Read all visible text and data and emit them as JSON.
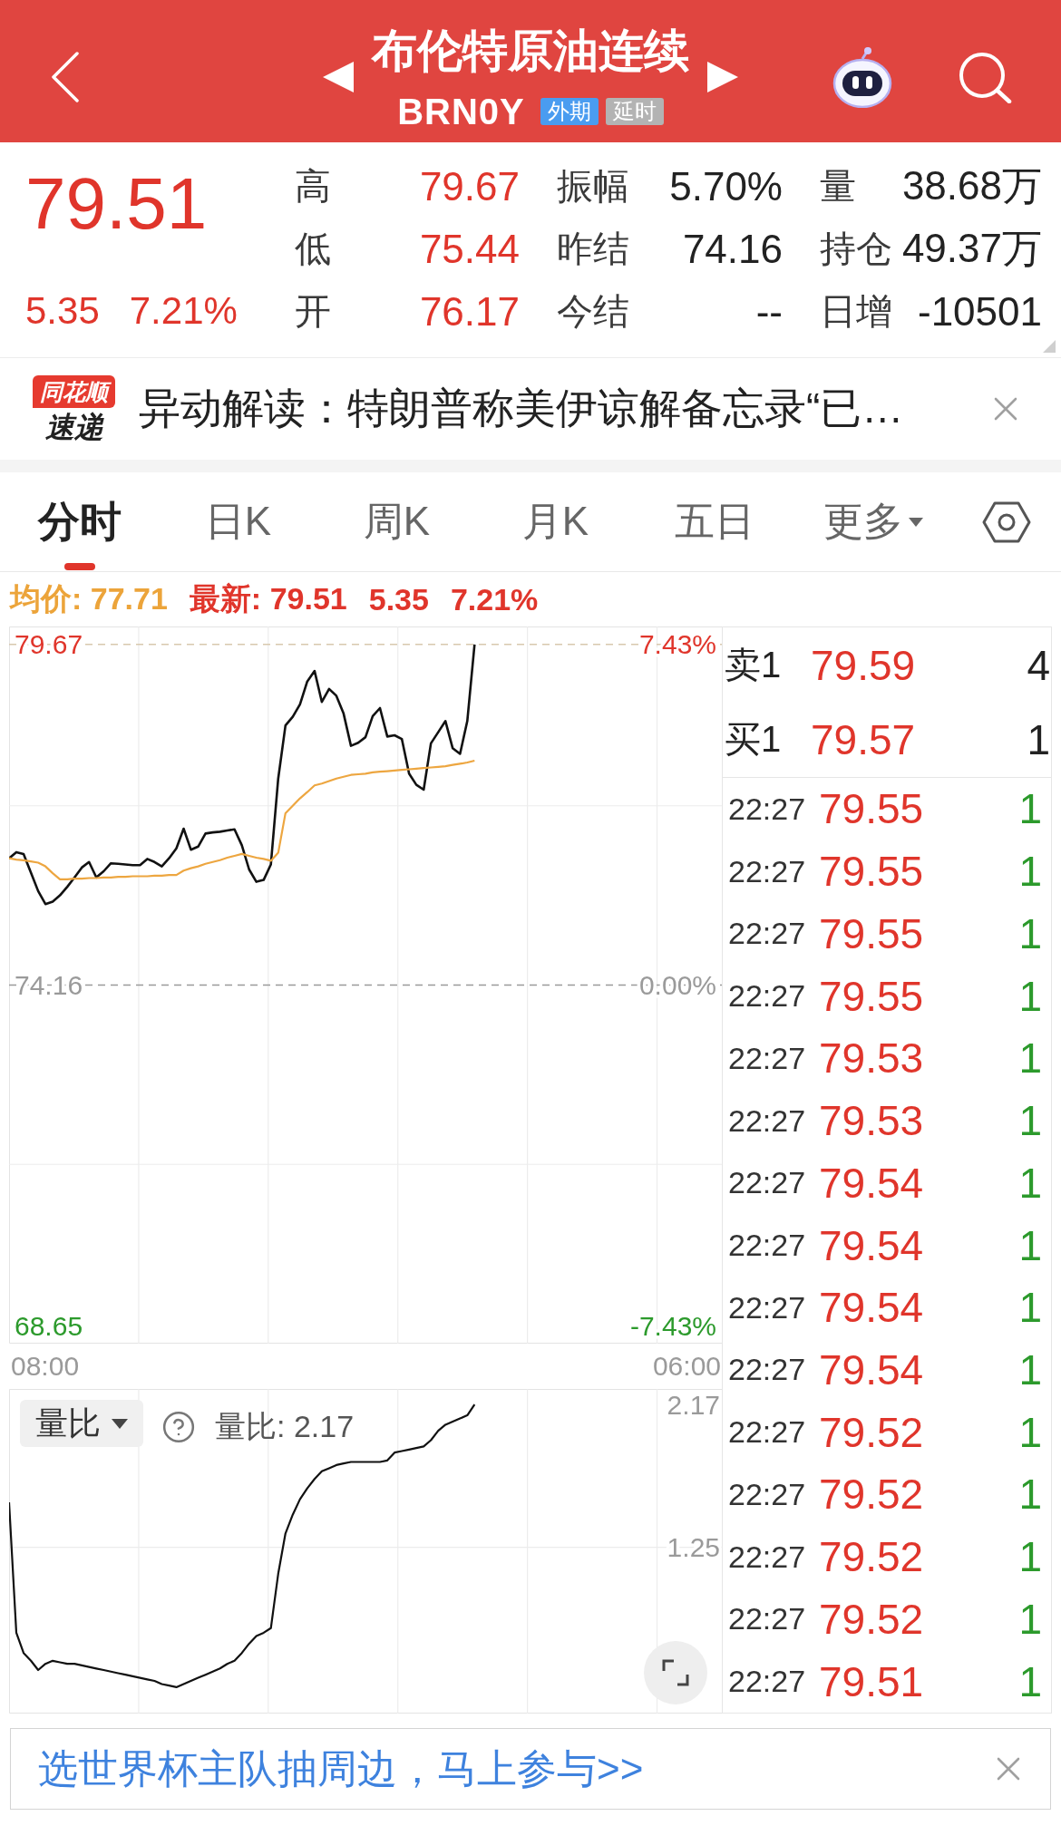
{
  "header": {
    "title": "布伦特原油连续",
    "code": "BRN0Y",
    "tags": [
      {
        "label": "外期",
        "color": "#4a9cf0"
      },
      {
        "label": "延时",
        "color": "#b3b3b3"
      }
    ]
  },
  "quote": {
    "price": "79.51",
    "change": "5.35",
    "percent": "7.21%",
    "stats": [
      {
        "label": "高",
        "value": "79.67",
        "color": "#e0352b"
      },
      {
        "label": "振幅",
        "value": "5.70%",
        "color": "#222222"
      },
      {
        "label": "量",
        "value": "38.68万",
        "color": "#222222"
      },
      {
        "label": "低",
        "value": "75.44",
        "color": "#e0352b"
      },
      {
        "label": "昨结",
        "value": "74.16",
        "color": "#222222"
      },
      {
        "label": "持仓",
        "value": "49.37万",
        "color": "#222222"
      },
      {
        "label": "开",
        "value": "76.17",
        "color": "#e0352b"
      },
      {
        "label": "今结",
        "value": "--",
        "color": "#222222"
      },
      {
        "label": "日增",
        "value": "-10501",
        "color": "#222222"
      }
    ]
  },
  "news": {
    "brand": "同花顺",
    "brand_sub": "速递",
    "headline": "异动解读：特朗普称美伊谅解备忘录“已…"
  },
  "tabs": [
    {
      "label": "分时",
      "selected": true,
      "kind": "tab"
    },
    {
      "label": "日K",
      "selected": false,
      "kind": "tab"
    },
    {
      "label": "周K",
      "selected": false,
      "kind": "tab"
    },
    {
      "label": "月K",
      "selected": false,
      "kind": "tab"
    },
    {
      "label": "五日",
      "selected": false,
      "kind": "tab"
    },
    {
      "label": "更多",
      "selected": false,
      "kind": "menu"
    }
  ],
  "summary": {
    "average": "均价: 77.71",
    "latest": "最新: 79.51",
    "change": "5.35",
    "percent": "7.21%"
  },
  "price_chart": {
    "right_labels": [
      "7.43%",
      "0.00%",
      "-7.43%"
    ],
    "chart_data": {
      "type": "line",
      "grid": true,
      "categories": [
        null,
        null,
        null,
        null,
        null,
        "08:00",
        null,
        null,
        null,
        null,
        null,
        null,
        null,
        null,
        null,
        null,
        null,
        null,
        null,
        null,
        null,
        null,
        null,
        null,
        null,
        null,
        null,
        null,
        null,
        null,
        null,
        null,
        null,
        null,
        null,
        null,
        null,
        null,
        null,
        null,
        null,
        null,
        null,
        null,
        null,
        null,
        null,
        null,
        null,
        null,
        null,
        null,
        null,
        null,
        null,
        null,
        null,
        null,
        null,
        null,
        null,
        null,
        null,
        null,
        null,
        null,
        null,
        null,
        null,
        null,
        null,
        null,
        null,
        null,
        null,
        null,
        null,
        null,
        null,
        null,
        null,
        null,
        null,
        null,
        null,
        null,
        null,
        null,
        null,
        null,
        null,
        null,
        null,
        "06:00",
        null,
        null,
        null,
        null,
        null
      ],
      "series": [
        {
          "color": "#111111",
          "values": [
            76.21,
            76.31,
            76.28,
            75.98,
            75.68,
            75.47,
            75.51,
            75.61,
            75.75,
            75.9,
            76.06,
            76.15,
            75.9,
            76.0,
            76.13,
            76.12,
            76.11,
            76.1,
            76.1,
            76.2,
            76.15,
            76.08,
            76.21,
            76.37,
            76.69,
            76.35,
            76.4,
            76.61,
            76.63,
            76.64,
            76.66,
            76.68,
            76.42,
            76.03,
            75.83,
            75.86,
            76.11,
            77.5,
            78.36,
            78.5,
            78.7,
            79.07,
            79.24,
            78.74,
            78.95,
            78.84,
            78.55,
            78.03,
            78.08,
            78.17,
            78.51,
            78.64,
            78.18,
            78.2,
            78.14,
            77.58,
            77.4,
            77.32,
            78.07,
            78.25,
            78.43,
            77.99,
            77.9,
            78.43,
            79.67,
            null,
            null,
            null,
            null,
            null,
            null,
            null,
            null,
            null,
            null,
            null,
            null,
            null,
            null,
            null,
            null,
            null,
            null,
            null,
            null,
            null,
            null,
            null,
            null,
            null,
            null,
            null,
            null,
            null,
            null,
            null,
            null,
            null,
            null
          ]
        },
        {
          "color": "#eda640",
          "values": [
            76.21,
            76.19,
            76.18,
            76.16,
            76.14,
            76.08,
            75.97,
            75.87,
            75.87,
            75.88,
            75.88,
            75.89,
            75.89,
            75.9,
            75.9,
            75.91,
            75.91,
            75.92,
            75.92,
            75.92,
            75.93,
            75.93,
            75.94,
            75.94,
            76.01,
            76.05,
            76.08,
            76.12,
            76.15,
            76.18,
            76.22,
            76.25,
            76.28,
            76.25,
            76.22,
            76.2,
            76.17,
            76.3,
            76.94,
            77.06,
            77.18,
            77.28,
            77.39,
            77.42,
            77.46,
            77.5,
            77.53,
            77.56,
            77.57,
            77.58,
            77.6,
            77.61,
            77.62,
            77.63,
            77.64,
            77.65,
            77.66,
            77.67,
            77.68,
            77.69,
            77.7,
            77.72,
            77.74,
            77.76,
            77.79,
            null,
            null,
            null,
            null,
            null,
            null,
            null,
            null,
            null,
            null,
            null,
            null,
            null,
            null,
            null,
            null,
            null,
            null,
            null,
            null,
            null,
            null,
            null,
            null,
            null,
            null,
            null,
            null,
            null,
            null,
            null,
            null,
            null,
            null
          ]
        }
      ],
      "ref_lines": [
        {
          "axis": "y",
          "value": 79.67,
          "color": "#d8c8ae"
        },
        {
          "axis": "y",
          "value": 74.16,
          "color": "#9a9a9a"
        }
      ],
      "ylim": [
        68.36,
        79.96
      ],
      "yticks": [
        {
          "value": 68.65,
          "label": "68.65"
        },
        {
          "value": 74.16,
          "label": "74.16"
        },
        {
          "value": 79.67,
          "label": "79.67"
        }
      ]
    }
  },
  "volume_chart": {
    "indicator": "量比",
    "reading": "量比: 2.17",
    "chart_data": {
      "type": "line",
      "grid": true,
      "categories": [
        null,
        null,
        null,
        null,
        null,
        null,
        null,
        null,
        null,
        null,
        null,
        null,
        null,
        null,
        null,
        null,
        null,
        null,
        null,
        null,
        null,
        null,
        null,
        null,
        null,
        null,
        null,
        null,
        null,
        null,
        null,
        null,
        null,
        null,
        null,
        null,
        null,
        null,
        null,
        null,
        null,
        null,
        null,
        null,
        null,
        null,
        null,
        null,
        null,
        null,
        null,
        null,
        null,
        null,
        null,
        null,
        null,
        null,
        null,
        null,
        null,
        null,
        null,
        null,
        null,
        null,
        null,
        null,
        null,
        null,
        null,
        null,
        null,
        null,
        null,
        null,
        null,
        null,
        null,
        null,
        null,
        null,
        null,
        null,
        null,
        null,
        null,
        null,
        null,
        null,
        null,
        null,
        null,
        null,
        null,
        null,
        null,
        null,
        null
      ],
      "series": [
        {
          "color": "#111111",
          "values": [
            1.54,
            0.7,
            0.57,
            0.52,
            0.46,
            0.5,
            0.52,
            0.51,
            0.5,
            0.5,
            0.49,
            0.48,
            0.47,
            0.46,
            0.45,
            0.44,
            0.43,
            0.42,
            0.41,
            0.4,
            0.39,
            0.37,
            0.36,
            0.35,
            0.37,
            0.39,
            0.41,
            0.43,
            0.45,
            0.47,
            0.5,
            0.52,
            0.57,
            0.63,
            0.68,
            0.7,
            0.73,
            1.08,
            1.34,
            1.46,
            1.56,
            1.63,
            1.69,
            1.74,
            1.76,
            1.78,
            1.79,
            1.8,
            1.8,
            1.8,
            1.8,
            1.8,
            1.81,
            1.86,
            1.87,
            1.88,
            1.89,
            1.9,
            1.94,
            2.0,
            2.04,
            2.06,
            2.08,
            2.1,
            2.17,
            null,
            null,
            null,
            null,
            null,
            null,
            null,
            null,
            null,
            null,
            null,
            null,
            null,
            null,
            null,
            null,
            null,
            null,
            null,
            null,
            null,
            null,
            null,
            null,
            null,
            null,
            null,
            null,
            null,
            null,
            null,
            null,
            null,
            null
          ]
        }
      ],
      "ylim": [
        0.18,
        2.27
      ],
      "yticks": [
        {
          "value": 1.25,
          "label": "1.25"
        },
        {
          "value": 2.17,
          "label": "2.17"
        }
      ]
    }
  },
  "order_book": [
    {
      "label": "卖1",
      "price": "79.59",
      "volume": "4"
    },
    {
      "label": "买1",
      "price": "79.57",
      "volume": "1"
    }
  ],
  "trades": [
    {
      "time": "22:27",
      "price": "79.55",
      "volume": "1"
    },
    {
      "time": "22:27",
      "price": "79.55",
      "volume": "1"
    },
    {
      "time": "22:27",
      "price": "79.55",
      "volume": "1"
    },
    {
      "time": "22:27",
      "price": "79.55",
      "volume": "1"
    },
    {
      "time": "22:27",
      "price": "79.53",
      "volume": "1"
    },
    {
      "time": "22:27",
      "price": "79.53",
      "volume": "1"
    },
    {
      "time": "22:27",
      "price": "79.54",
      "volume": "1"
    },
    {
      "time": "22:27",
      "price": "79.54",
      "volume": "1"
    },
    {
      "time": "22:27",
      "price": "79.54",
      "volume": "1"
    },
    {
      "time": "22:27",
      "price": "79.54",
      "volume": "1"
    },
    {
      "time": "22:27",
      "price": "79.52",
      "volume": "1"
    },
    {
      "time": "22:27",
      "price": "79.52",
      "volume": "1"
    },
    {
      "time": "22:27",
      "price": "79.52",
      "volume": "1"
    },
    {
      "time": "22:27",
      "price": "79.52",
      "volume": "1"
    },
    {
      "time": "22:27",
      "price": "79.51",
      "volume": "1"
    }
  ],
  "banner": {
    "text": "选世界杯主队抽周边，马上参与>>"
  }
}
